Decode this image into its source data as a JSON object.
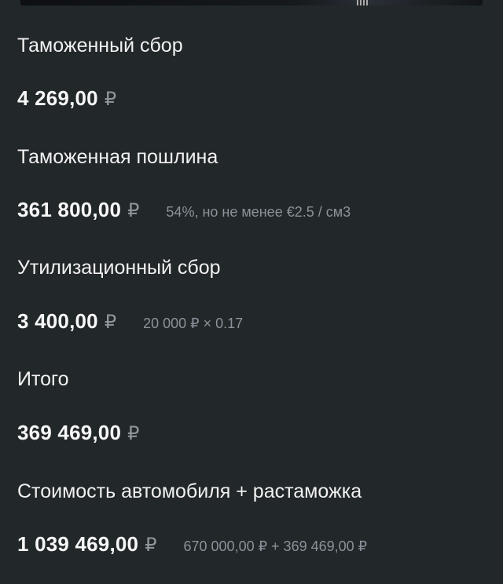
{
  "currency_symbol": "₽",
  "items": [
    {
      "label": "Таможенный сбор",
      "amount": "4 269,00",
      "note": ""
    },
    {
      "label": "Таможенная пошлина",
      "amount": "361 800,00",
      "note": "54%, но не менее €2.5 / см3"
    },
    {
      "label": "Утилизационный сбор",
      "amount": "3 400,00",
      "note": "20 000 ₽ × 0.17"
    },
    {
      "label": "Итого",
      "amount": "369 469,00",
      "note": ""
    },
    {
      "label": "Стоимость автомобиля + растаможка",
      "amount": "1 039 469,00",
      "note": "670 000,00 ₽ + 369 469,00 ₽"
    }
  ],
  "colors": {
    "background": "#22272a",
    "primary_text": "#f2f2f2",
    "secondary_text": "#8b939a"
  }
}
